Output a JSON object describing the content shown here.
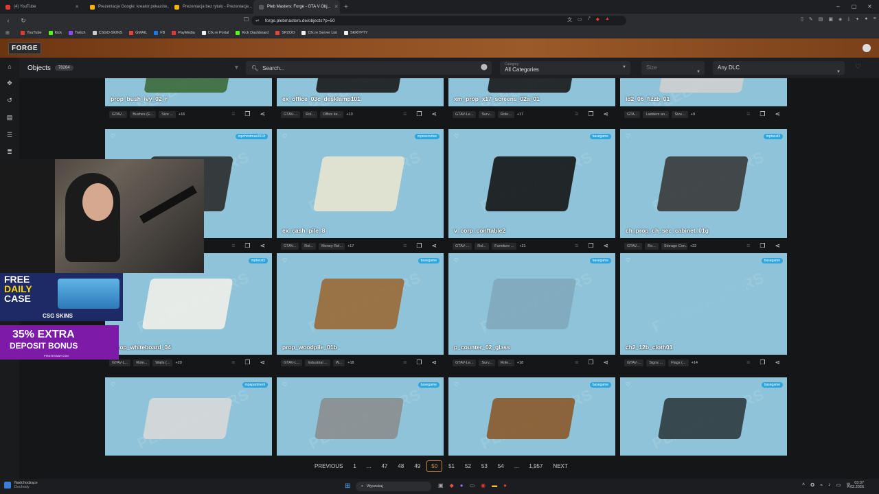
{
  "browser": {
    "tabs": [
      {
        "label": "(4) YouTube",
        "color": "#e53935",
        "active": false
      },
      {
        "label": "Prezentacje Google: kreator pokazów...",
        "color": "#f4b400",
        "active": false
      },
      {
        "label": "Prezentacja bez tytułu - Prezentacje...",
        "color": "#f4b400",
        "active": false
      },
      {
        "label": "Pleb Masters: Forge - GTA V Obj...",
        "color": "#5a5a5a",
        "active": true
      }
    ],
    "url": "forge.plebmasters.de/objects?p=50",
    "bookmarks": [
      {
        "label": "YouTube",
        "color": "#e53935"
      },
      {
        "label": "Kick",
        "color": "#53fc18"
      },
      {
        "label": "Twitch",
        "color": "#9146ff"
      },
      {
        "label": "CSGO-SKINS",
        "color": "#cccccc"
      },
      {
        "label": "GMAIL",
        "color": "#ea4335"
      },
      {
        "label": "FB",
        "color": "#1877f2"
      },
      {
        "label": "PayMedia",
        "color": "#e53935"
      },
      {
        "label": "Cfx.re Portal",
        "color": "#f0f0f0"
      },
      {
        "label": "Kick Dashboard",
        "color": "#53fc18"
      },
      {
        "label": "SPZOO",
        "color": "#ea4335"
      },
      {
        "label": "Cfx.re Server List",
        "color": "#f0f0f0"
      },
      {
        "label": "SKRYPTY",
        "color": "#f0f0f0"
      }
    ]
  },
  "site": {
    "logo": "FORGE",
    "objects_label": "Objects",
    "objects_count": "78264",
    "search_placeholder": "Search...",
    "category_label": "Category",
    "category_value": "All Categories",
    "size_placeholder": "Size",
    "dlc_value": "Any DLC"
  },
  "cards": [
    {
      "name": "prop_bush_ivy_02_r",
      "badge": "",
      "tags": [
        "GTAV...",
        "Bushes (E...",
        "Size ..."
      ],
      "more": "+16",
      "color": "#3d6b3a"
    },
    {
      "name": "ex_office_03c_desklamp101",
      "badge": "",
      "tags": [
        "GTAV-...",
        "Rol...",
        "Office ite..."
      ],
      "more": "+13",
      "color": "#1a1a1a"
    },
    {
      "name": "xm_prop_x17_screens_02a_01",
      "badge": "",
      "tags": [
        "GTAV-Le...",
        "Surv...",
        "Role..."
      ],
      "more": "+17",
      "color": "#1a1a1a"
    },
    {
      "name": "id2_06_fizzb_01",
      "badge": "",
      "tags": [
        "GTA...",
        "Ladders an...",
        "Size..."
      ],
      "more": "+9",
      "color": "#cfcfcf"
    },
    {
      "name": "",
      "badge": "mpchristmas2018",
      "tags": [],
      "more": "",
      "color": "#2b2b2b"
    },
    {
      "name": "ex_cash_pile_8",
      "badge": "mpexecutive",
      "tags": [
        "GTAV...",
        "Rol...",
        "Money Rel..."
      ],
      "more": "+17",
      "color": "#e8e4cf"
    },
    {
      "name": "v_corp_conftable2",
      "badge": "basegame",
      "tags": [
        "GTAV-...",
        "Rol...",
        "Furniture ..."
      ],
      "more": "+21",
      "color": "#151515"
    },
    {
      "name": "ch_prop_ch_sec_cabinet_01g",
      "badge": "mpheist3",
      "tags": [
        "GTAV...",
        "Ro...",
        "Storage Con..."
      ],
      "more": "+22",
      "color": "#3a3a3a"
    },
    {
      "name": "_prop_whiteboard_04",
      "badge": "mpheist3",
      "tags": [
        "GTAV-L...",
        "Role...",
        "Walls (..."
      ],
      "more": "+20",
      "color": "#f1efe9"
    },
    {
      "name": "prop_woodpile_01b",
      "badge": "basegame",
      "tags": [
        "GTAV-L...",
        "Industrial ...",
        "W..."
      ],
      "more": "+18",
      "color": "#9a6a35"
    },
    {
      "name": "p_counter_02_glass",
      "badge": "basegame",
      "tags": [
        "GTAV-Le...",
        "Surv...",
        "Role..."
      ],
      "more": "+18",
      "color": "#7fa9bb"
    },
    {
      "name": "ch2_12b_cloth01",
      "badge": "basegame",
      "tags": [
        "GTAV-...",
        "Signs ...",
        "Flags (..."
      ],
      "more": "+14",
      "color": "#8fc3d9"
    },
    {
      "name": "",
      "badge": "mpapartment",
      "tags": [],
      "more": "",
      "color": "#d8d8d8"
    },
    {
      "name": "",
      "badge": "basegame",
      "tags": [],
      "more": "",
      "color": "#8a8f8f"
    },
    {
      "name": "",
      "badge": "basegame",
      "tags": [],
      "more": "",
      "color": "#8a5a2a"
    },
    {
      "name": "",
      "badge": "basegame",
      "tags": [],
      "more": "",
      "color": "#2e3b3f"
    }
  ],
  "pagination": {
    "prev": "PREVIOUS",
    "pages": [
      "1",
      "...",
      "47",
      "48",
      "49",
      "50",
      "51",
      "52",
      "53",
      "54",
      "...",
      "1,957"
    ],
    "current": "50",
    "next": "NEXT"
  },
  "overlay": {
    "ad1_line1": "FREE",
    "ad1_line2": "DAILY",
    "ad1_line3": "CASE",
    "ad1_brand": "CSG SKINS",
    "ad2_line1": "35% EXTRA",
    "ad2_line2": "DEPOSIT BONUS",
    "ad2_site": "PIRATESWAP.COM"
  },
  "taskbar": {
    "weather_title": "Nadchodzące",
    "weather_sub": "Dochody",
    "search_label": "Wyszukaj",
    "time": "03:37",
    "date": "7.02.2026"
  }
}
